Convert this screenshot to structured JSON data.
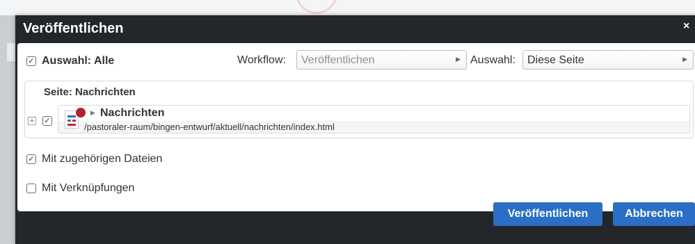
{
  "dialog": {
    "title": "Veröffentlichen",
    "close_label": "×"
  },
  "selection": {
    "select_all_label": "Auswahl: Alle",
    "workflow_label": "Workflow:",
    "workflow_value": "Veröffentlichen",
    "auswahl_label": "Auswahl:",
    "auswahl_value": "Diese Seite"
  },
  "page": {
    "heading": "Seite: Nachrichten",
    "item_title": "Nachrichten",
    "item_path": "/pastoraler-raum/bingen-entwurf/aktuell/nachrichten/index.html"
  },
  "options": {
    "related_files_label": "Mit zugehörigen Dateien",
    "related_files_checked": true,
    "links_label": "Mit Verknüpfungen",
    "links_checked": false
  },
  "footer": {
    "publish_label": "Veröffentlichen",
    "cancel_label": "Abbrechen"
  },
  "icons": {
    "checkbox_checked": "check-icon",
    "expander": "plus-icon",
    "caret": "caret-right-icon",
    "page": "page-icon",
    "status": "status-dot-icon"
  },
  "colors": {
    "header_bg": "#23262b",
    "primary_button": "#2a6ec6",
    "status_dot": "#b3202f"
  }
}
